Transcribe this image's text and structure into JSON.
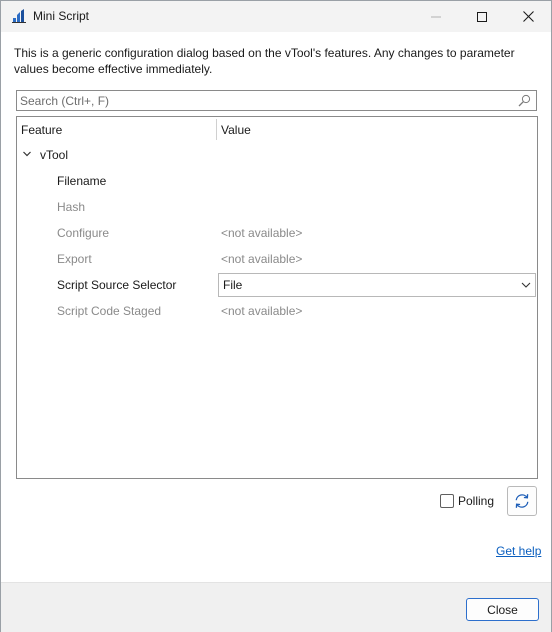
{
  "window": {
    "title": "Mini Script"
  },
  "description": "This is a generic configuration dialog based on the vTool's features. Any changes to parameter values become effective immediately.",
  "search": {
    "placeholder": "Search (Ctrl+, F)",
    "value": ""
  },
  "grid": {
    "headers": {
      "feature": "Feature",
      "value": "Value"
    },
    "root": {
      "label": "vTool",
      "expanded": true
    },
    "rows": [
      {
        "feature": "Filename",
        "value": "",
        "enabled": true
      },
      {
        "feature": "Hash",
        "value": "",
        "enabled": false
      },
      {
        "feature": "Configure",
        "value": "<not available>",
        "enabled": false
      },
      {
        "feature": "Export",
        "value": "<not available>",
        "enabled": false
      },
      {
        "feature": "Script Source Selector",
        "value": "File",
        "enabled": true,
        "control": "dropdown"
      },
      {
        "feature": "Script Code Staged",
        "value": "<not available>",
        "enabled": false
      }
    ]
  },
  "polling": {
    "label": "Polling",
    "checked": false
  },
  "refresh": {
    "icon": "refresh-icon"
  },
  "help": {
    "label": "Get help"
  },
  "footer": {
    "close_label": "Close"
  },
  "colors": {
    "link": "#0b5fbf",
    "accent_border": "#2d6fcc",
    "disabled_text": "#8a8a8a"
  }
}
